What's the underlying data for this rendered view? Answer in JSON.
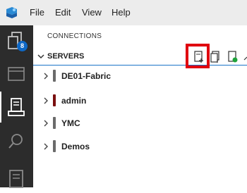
{
  "menubar": {
    "items": [
      "File",
      "Edit",
      "View",
      "Help"
    ]
  },
  "activity_bar": {
    "badge_count": "8",
    "icons": [
      "files-icon",
      "windows-icon",
      "connections-icon",
      "search-icon",
      "notebook-icon"
    ]
  },
  "panel": {
    "title": "CONNECTIONS",
    "section_label": "SERVERS",
    "toolbar": [
      "new-connection-icon",
      "new-server-group-icon",
      "active-connections-icon",
      "more-icon"
    ]
  },
  "servers": [
    {
      "label": "DE01-Fabric",
      "color": "#6a6a6a"
    },
    {
      "label": "admin",
      "color": "#7a0f0f"
    },
    {
      "label": "YMC",
      "color": "#6a6a6a"
    },
    {
      "label": "Demos",
      "color": "#6a6a6a"
    }
  ],
  "colors": {
    "highlight": "#e0000f",
    "accent": "#0e68c6",
    "activity_bar": "#2c2c2c"
  }
}
